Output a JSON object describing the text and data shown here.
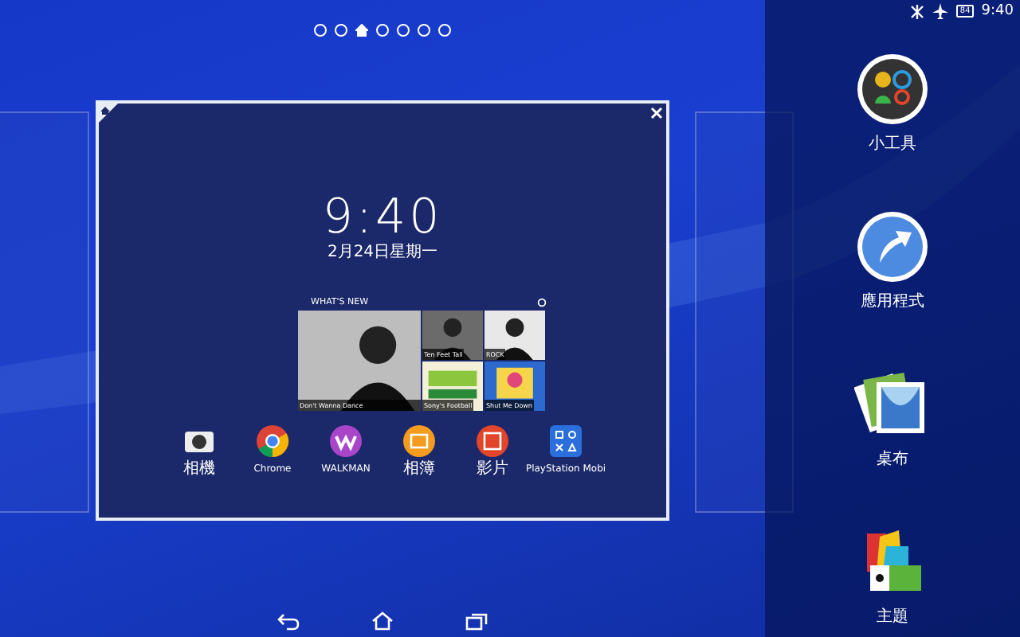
{
  "status_bar": {
    "battery": "84",
    "time": "9:40"
  },
  "pages": [
    {
      "kind": "dot",
      "selected": false
    },
    {
      "kind": "dot",
      "selected": false
    },
    {
      "kind": "home",
      "selected": true
    },
    {
      "kind": "dot",
      "selected": false
    },
    {
      "kind": "dot",
      "selected": false
    },
    {
      "kind": "dot",
      "selected": false
    },
    {
      "kind": "dot",
      "selected": false
    }
  ],
  "preview": {
    "clock": "9:40",
    "date": "2月24日星期一",
    "widget": {
      "title": "WHAT'S NEW",
      "featured": {
        "caption": "Don't Wanna Dance",
        "kind": "picture"
      },
      "tiles": [
        {
          "caption": "Ten Feet Tall",
          "kind": "picture"
        },
        {
          "caption": "ROCK",
          "kind": "picture"
        },
        {
          "caption": "Sony's Football",
          "kind": "picture"
        },
        {
          "caption": "Shut Me Down",
          "kind": "picture"
        }
      ]
    },
    "apps": [
      {
        "label": "相機",
        "kind": "camera"
      },
      {
        "label": "Chrome",
        "kind": "chrome"
      },
      {
        "label": "WALKMAN",
        "kind": "walkman"
      },
      {
        "label": "相簿",
        "kind": "album"
      },
      {
        "label": "影片",
        "kind": "movies"
      },
      {
        "label": "PlayStation Mobi",
        "kind": "playstation"
      }
    ]
  },
  "side_menu": [
    {
      "label": "小工具",
      "kind": "widgets"
    },
    {
      "label": "應用程式",
      "kind": "apps"
    },
    {
      "label": "桌布",
      "kind": "wallpaper"
    },
    {
      "label": "主題",
      "kind": "themes"
    }
  ]
}
